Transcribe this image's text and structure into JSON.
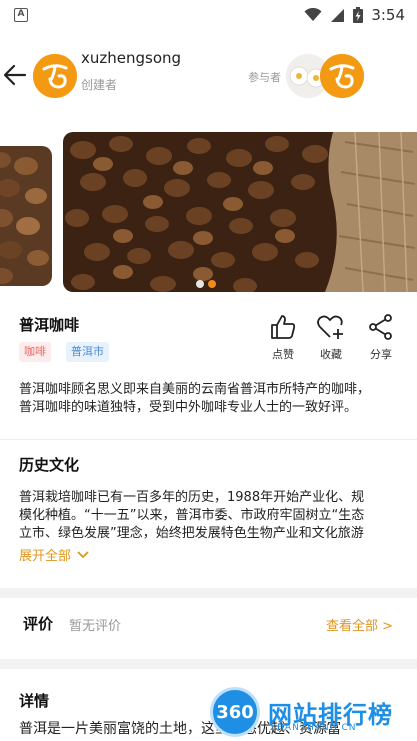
{
  "status_bar": {
    "time": "3:54",
    "app_icon": "a-notification-icon",
    "icons": [
      "wifi-icon",
      "signal-icon",
      "battery-charging-icon"
    ]
  },
  "header": {
    "back_icon": "back-arrow-icon",
    "creator_name": "xuzhengsong",
    "creator_role": "创建者",
    "participants_label": "参与者"
  },
  "carousel": {
    "slide_count": 2,
    "active_index": 1
  },
  "item": {
    "title": "普洱咖啡",
    "tags": [
      "咖啡",
      "普洱市"
    ],
    "actions": [
      {
        "label": "点赞",
        "icon": "thumbs-up-icon"
      },
      {
        "label": "收藏",
        "icon": "heart-plus-icon"
      },
      {
        "label": "分享",
        "icon": "share-icon"
      }
    ],
    "intro_line1": "普洱咖啡顾名思义即来自美丽的云南省普洱市所特产的咖啡，",
    "intro_line2": "普洱咖啡的味道独特，受到中外咖啡专业人士的一致好评。"
  },
  "history": {
    "title": "历史文化",
    "line1": "普洱栽培咖啡已有一百多年的历史，1988年开始产业化、规",
    "line2": "模化种植。“十一五”以来，普洱市委、市政府牢固树立“生态",
    "line3": "立市、绿色发展”理念，始终把发展特色生物产业和文化旅游",
    "expand_label": "展开全部"
  },
  "review": {
    "title": "评价",
    "empty_text": "暂无评价",
    "view_all": "查看全部 >"
  },
  "details": {
    "title": "详情",
    "text": "普洱是一片美丽富饶的土地，这里生态优越、资源富"
  },
  "watermark": {
    "logo_text": "360",
    "text": "网站排行榜",
    "url": "ZHANZHANG.CN"
  },
  "colors": {
    "accent": "#f08c1c",
    "avatar": "#f39a12",
    "tag_coffee_bg": "#fdeceb",
    "tag_city_bg": "#e8f2fc"
  }
}
